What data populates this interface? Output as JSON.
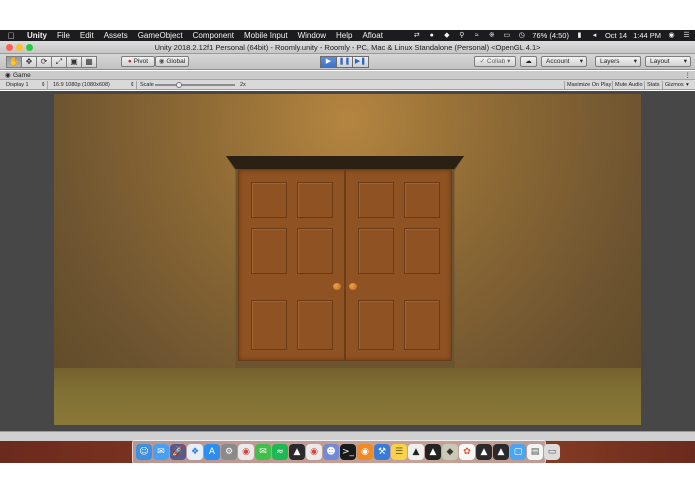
{
  "menubar": {
    "apple_icon": "apple-icon",
    "items": [
      "Unity",
      "File",
      "Edit",
      "Assets",
      "GameObject",
      "Component",
      "Mobile Input",
      "Window",
      "Help",
      "Afloat"
    ],
    "battery": "76% (4:50)",
    "date": "Oct 14",
    "time": "1:44 PM"
  },
  "window": {
    "title": "Unity 2018.2.12f1 Personal (64bit) - Roomly.unity - Roomly - PC, Mac & Linux Standalone (Personal) <OpenGL 4.1>",
    "traffic_colors": [
      "#fe5f57",
      "#febc2e",
      "#28c840"
    ]
  },
  "toolbar": {
    "tools": [
      "hand-tool-icon",
      "move-tool-icon",
      "rotate-tool-icon",
      "scale-tool-icon",
      "rect-tool-icon",
      "transform-tool-icon"
    ],
    "pivot": "Pivot",
    "global": "Global",
    "collab": "Collab",
    "account": "Account",
    "layers": "Layers",
    "layout": "Layout"
  },
  "game": {
    "tab": "Game",
    "display": "Display 1",
    "resolution": "16:9 1080p (1080x608)",
    "scale_label": "Scale",
    "scale_value": "2x",
    "maximize": "Maximize On Play",
    "mute": "Mute Audio",
    "stats": "Stats",
    "gizmos": "Gizmos"
  },
  "dock": {
    "icons": [
      "finder-icon",
      "mail-icon",
      "launchpad-icon",
      "safari-icon",
      "app-store-icon",
      "system-preferences-icon",
      "chrome-icon",
      "messages-icon",
      "spotify-icon",
      "unity-icon",
      "chrome-icon",
      "discord-icon",
      "terminal-icon",
      "blender-icon",
      "xcode-icon",
      "notes-icon",
      "unity-icon",
      "unity-icon",
      "inkscape-icon",
      "photos-icon",
      "unity-icon",
      "unity-icon",
      "finder-folder-icon",
      "document-icon",
      "trash-icon"
    ]
  }
}
